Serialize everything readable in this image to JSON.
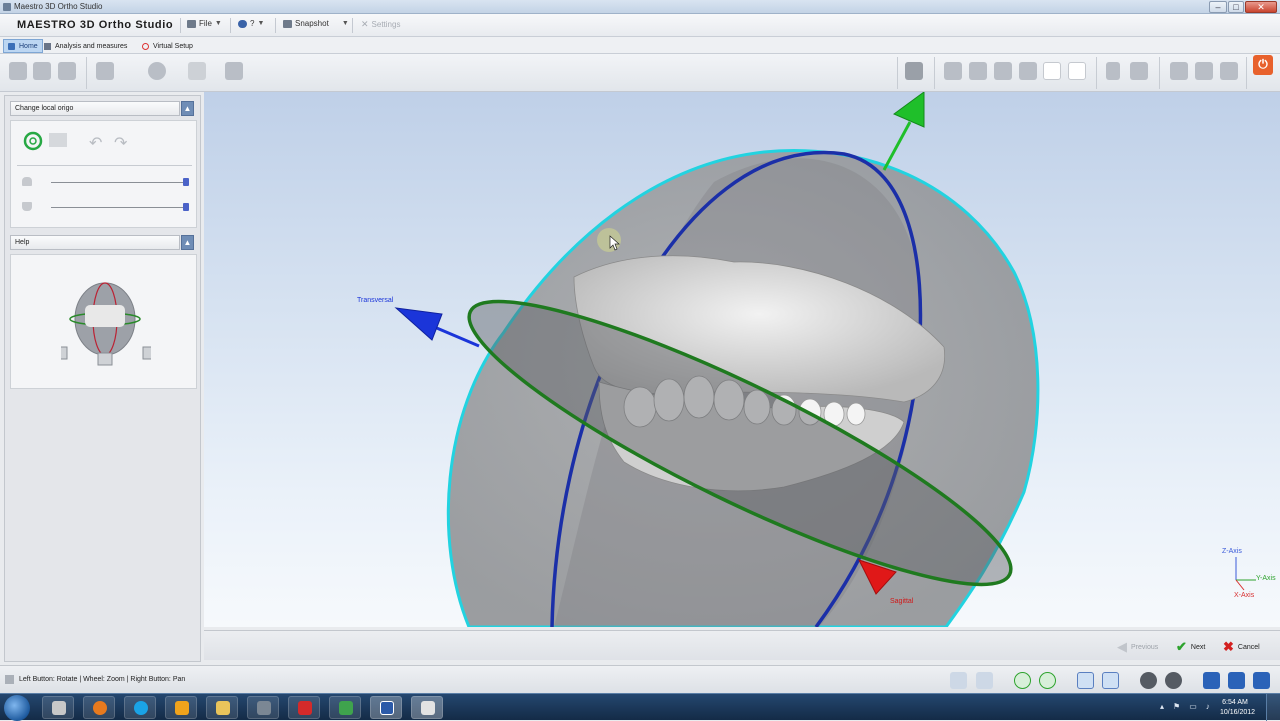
{
  "window": {
    "title": "Maestro 3D Ortho Studio",
    "buttons": [
      "–",
      "□",
      "✕"
    ]
  },
  "menubar": {
    "app_title": "MAESTRO 3D Ortho Studio",
    "items": [
      {
        "label": "File",
        "icon": "file-icon"
      },
      {
        "label": "?",
        "icon": "help-icon"
      },
      {
        "label": "Snapshot",
        "icon": "camera-icon"
      },
      {
        "label": "Settings",
        "icon": "settings-icon",
        "disabled": true
      }
    ]
  },
  "tabs": [
    {
      "label": "Home",
      "active": true
    },
    {
      "label": "Analysis and measures",
      "active": false
    },
    {
      "label": "Virtual Setup",
      "active": false
    }
  ],
  "left_panel": {
    "origin_section": {
      "title": "Change local origo",
      "collapse": "▲"
    },
    "help_section": {
      "title": "Help",
      "collapse": "▲"
    },
    "sliders": [
      {
        "icon": "upper-jaw-icon",
        "value": 1.0
      },
      {
        "icon": "lower-jaw-icon",
        "value": 1.0
      }
    ]
  },
  "viewport": {
    "labels": {
      "transversal": "Transversal",
      "sagittal": "Sagittal"
    },
    "axes": {
      "z": "Z-Axis",
      "y": "Y-Axis",
      "x": "X-Axis"
    },
    "colors": {
      "sphere_edge": "#22d3e0",
      "transversal_ring": "#1f7a1f",
      "sagittal_ring": "#1b2fa8",
      "arrow_green": "#1fbf2a",
      "arrow_blue": "#1b35d9",
      "arrow_red": "#e01818"
    }
  },
  "navbar": {
    "previous": "Previous",
    "next": "Next",
    "cancel": "Cancel"
  },
  "statusbar": {
    "message": "Left Button: Rotate | Wheel: Zoom | Right Button: Pan"
  },
  "taskbar": {
    "time": "6:54 AM",
    "date": "10/16/2012"
  }
}
